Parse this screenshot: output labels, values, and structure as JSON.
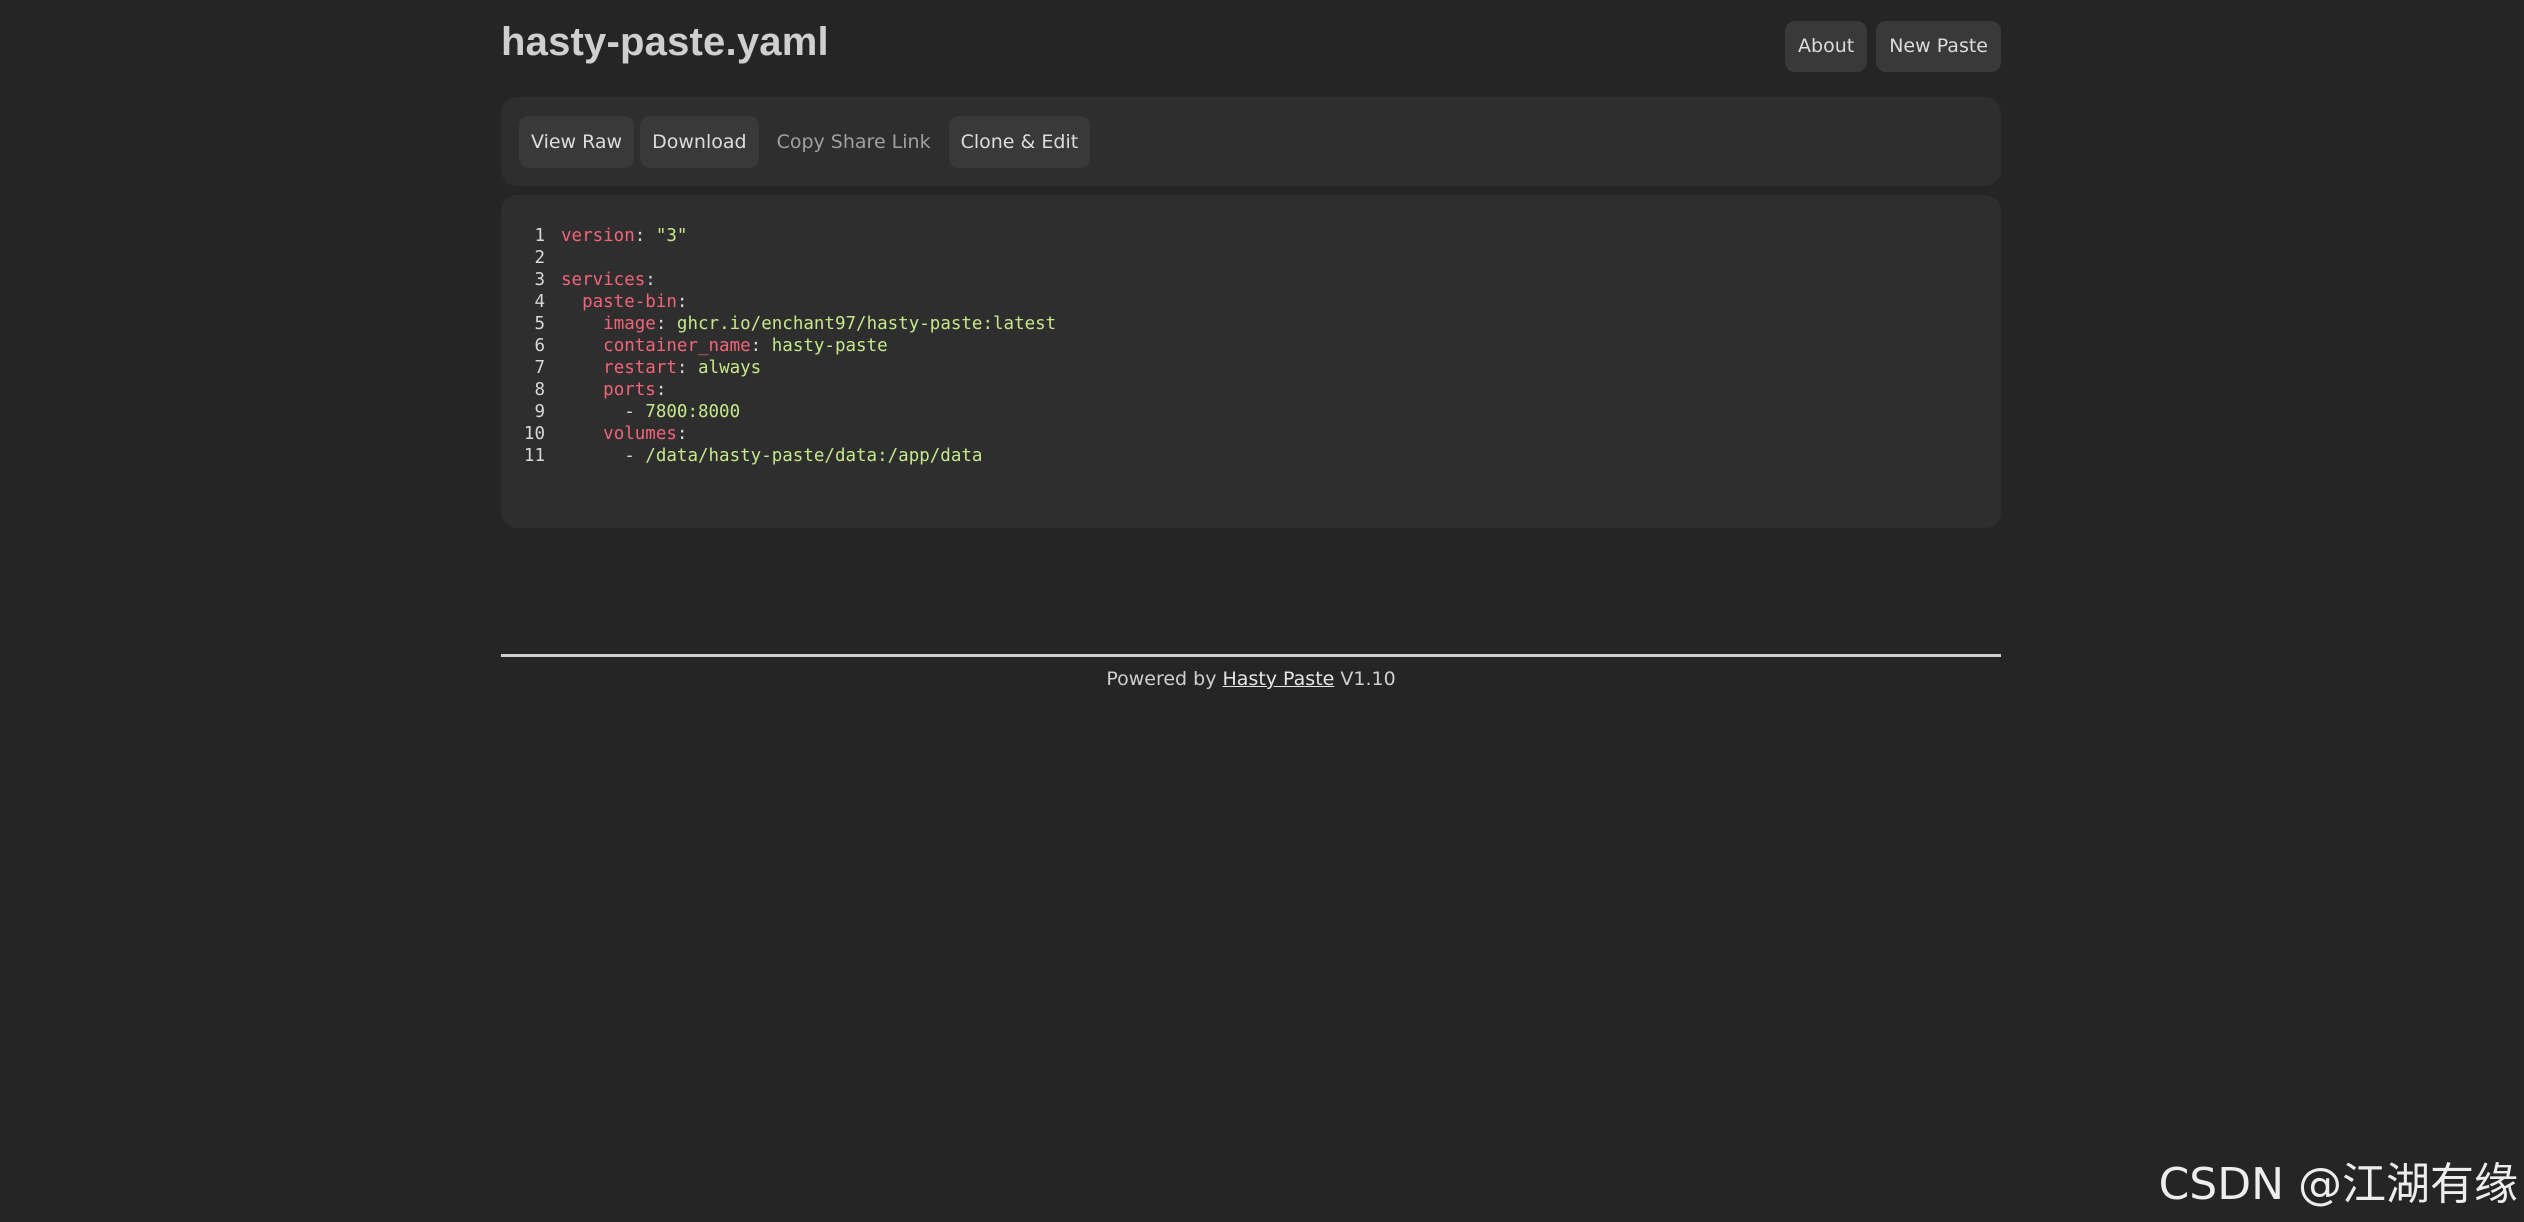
{
  "header": {
    "title": "hasty-paste.yaml",
    "nav": [
      {
        "label": "About"
      },
      {
        "label": "New Paste"
      }
    ]
  },
  "toolbar": {
    "buttons": [
      {
        "label": "View Raw"
      },
      {
        "label": "Download"
      },
      {
        "label": "Copy Share Link"
      },
      {
        "label": "Clone & Edit"
      }
    ]
  },
  "code": {
    "lines": [
      {
        "num": "1",
        "indent": "",
        "key": "version",
        "sep": ": ",
        "value": "\"3\""
      },
      {
        "num": "2",
        "indent": "",
        "key": "",
        "sep": "",
        "value": ""
      },
      {
        "num": "3",
        "indent": "",
        "key": "services",
        "sep": ":",
        "value": ""
      },
      {
        "num": "4",
        "indent": "  ",
        "key": "paste-bin",
        "sep": ":",
        "value": ""
      },
      {
        "num": "5",
        "indent": "    ",
        "key": "image",
        "sep": ": ",
        "value": "ghcr.io/enchant97/hasty-paste:latest"
      },
      {
        "num": "6",
        "indent": "    ",
        "key": "container_name",
        "sep": ": ",
        "value": "hasty-paste"
      },
      {
        "num": "7",
        "indent": "    ",
        "key": "restart",
        "sep": ": ",
        "value": "always"
      },
      {
        "num": "8",
        "indent": "    ",
        "key": "ports",
        "sep": ":",
        "value": ""
      },
      {
        "num": "9",
        "indent": "      ",
        "key": "",
        "sep": "- ",
        "value": "7800:8000"
      },
      {
        "num": "10",
        "indent": "    ",
        "key": "volumes",
        "sep": ":",
        "value": ""
      },
      {
        "num": "11",
        "indent": "      ",
        "key": "",
        "sep": "- ",
        "value": "/data/hasty-paste/data:/app/data"
      }
    ]
  },
  "footer": {
    "prefix": "Powered by ",
    "link_label": "Hasty Paste",
    "version": " V1.10"
  },
  "watermark": {
    "main": "CSDN @江湖有缘",
    "small": "CSDN @江湖有缘"
  }
}
